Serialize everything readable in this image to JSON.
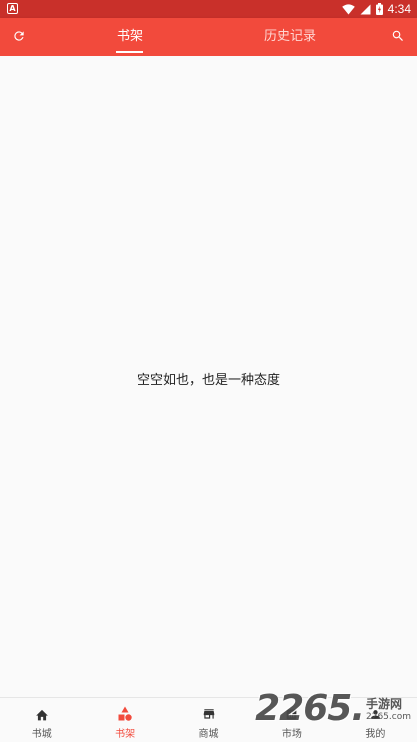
{
  "status_bar": {
    "app_badge": "A",
    "time": "4:34",
    "icons": [
      "wifi-icon",
      "signal-icon",
      "battery-icon"
    ]
  },
  "app_bar": {
    "refresh_icon": "refresh-icon",
    "search_icon": "search-icon",
    "tabs": [
      {
        "label": "书架",
        "active": true
      },
      {
        "label": "历史记录",
        "active": false
      }
    ],
    "colors": {
      "background": "#f24a3c",
      "status_bar": "#c9302a"
    }
  },
  "content": {
    "empty_message": "空空如也，也是一种态度"
  },
  "bottom_nav": {
    "items": [
      {
        "label": "书城",
        "icon": "home-icon",
        "active": false
      },
      {
        "label": "书架",
        "icon": "shapes-icon",
        "active": true
      },
      {
        "label": "商城",
        "icon": "store-icon",
        "active": false
      },
      {
        "label": "市场",
        "icon": "chart-icon",
        "active": false
      },
      {
        "label": "我的",
        "icon": "person-icon",
        "active": false
      }
    ],
    "active_color": "#f24a3c"
  },
  "watermark": {
    "big": "2265",
    "dot": ".",
    "cn": "手游网",
    "en": "2265.com"
  }
}
